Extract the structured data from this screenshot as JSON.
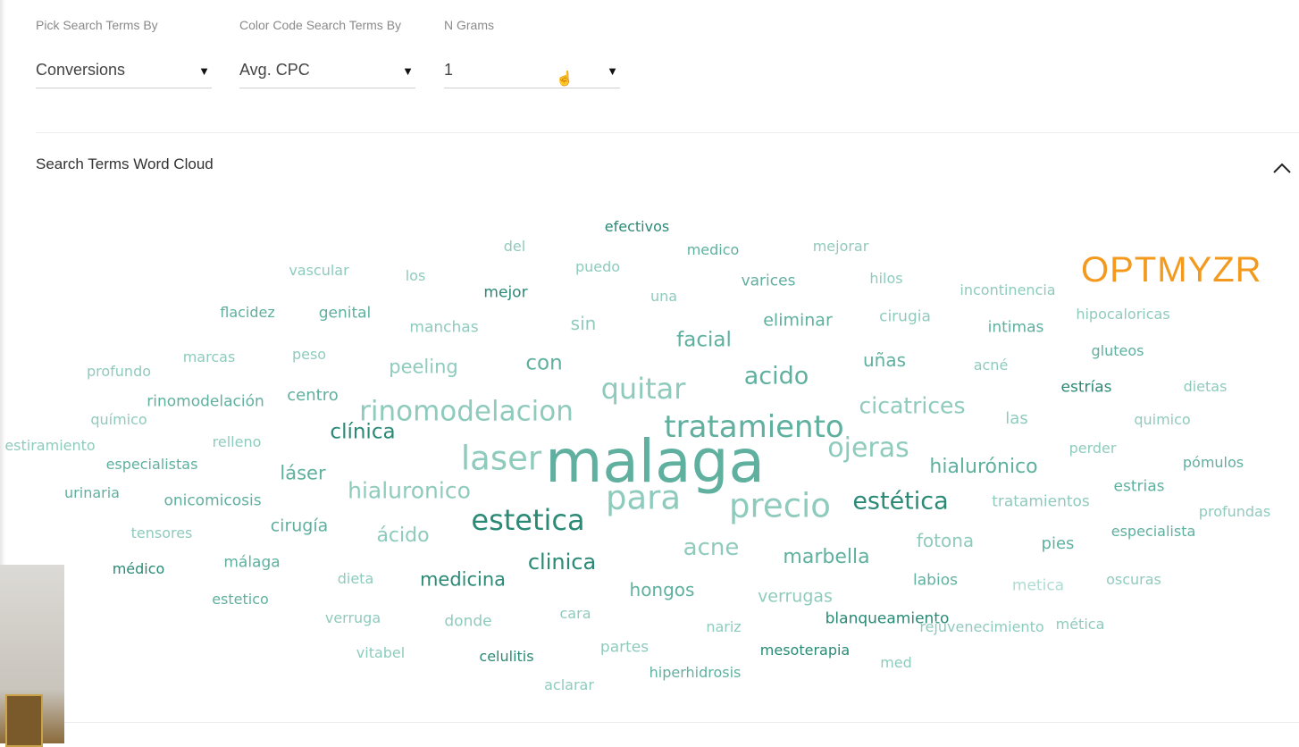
{
  "controls": [
    {
      "label": "Pick Search Terms By",
      "value": "Conversions"
    },
    {
      "label": "Color Code Search Terms By",
      "value": "Avg. CPC"
    },
    {
      "label": "N Grams",
      "value": "1"
    }
  ],
  "section": {
    "title": "Search Terms Word Cloud",
    "collapse_icon": "chevron-up-icon"
  },
  "logo": "OPTMYZR",
  "colors": {
    "dark": "#2a8a76",
    "mid": "#5fb09f",
    "light": "#8fcbbd",
    "lightest": "#aedcd2",
    "logo": "#f39a1e"
  },
  "word_cloud": [
    {
      "text": "efectivos",
      "shade": "dark"
    },
    {
      "text": "medico",
      "shade": "mid"
    },
    {
      "text": "del",
      "shade": "light"
    },
    {
      "text": "mejorar",
      "shade": "light"
    },
    {
      "text": "vascular",
      "shade": "light"
    },
    {
      "text": "los",
      "shade": "light"
    },
    {
      "text": "puedo",
      "shade": "light"
    },
    {
      "text": "hilos",
      "shade": "light"
    },
    {
      "text": "varices",
      "shade": "mid"
    },
    {
      "text": "mejor",
      "shade": "dark"
    },
    {
      "text": "una",
      "shade": "light"
    },
    {
      "text": "incontinencia",
      "shade": "light"
    },
    {
      "text": "flacidez",
      "shade": "mid"
    },
    {
      "text": "genital",
      "shade": "mid"
    },
    {
      "text": "manchas",
      "shade": "light"
    },
    {
      "text": "sin",
      "shade": "light"
    },
    {
      "text": "eliminar",
      "shade": "mid"
    },
    {
      "text": "cirugia",
      "shade": "light"
    },
    {
      "text": "intimas",
      "shade": "mid"
    },
    {
      "text": "hipocaloricas",
      "shade": "light"
    },
    {
      "text": "facial",
      "shade": "mid"
    },
    {
      "text": "marcas",
      "shade": "light"
    },
    {
      "text": "peso",
      "shade": "light"
    },
    {
      "text": "peeling",
      "shade": "light"
    },
    {
      "text": "con",
      "shade": "mid"
    },
    {
      "text": "acido",
      "shade": "mid"
    },
    {
      "text": "uñas",
      "shade": "mid"
    },
    {
      "text": "acné",
      "shade": "light"
    },
    {
      "text": "gluteos",
      "shade": "mid"
    },
    {
      "text": "profundo",
      "shade": "light"
    },
    {
      "text": "quitar",
      "shade": "light"
    },
    {
      "text": "rinomodelación",
      "shade": "mid"
    },
    {
      "text": "centro",
      "shade": "mid"
    },
    {
      "text": "estrías",
      "shade": "dark"
    },
    {
      "text": "dietas",
      "shade": "light"
    },
    {
      "text": "rinomodelacion",
      "shade": "light"
    },
    {
      "text": "cicatrices",
      "shade": "light"
    },
    {
      "text": "tratamiento",
      "shade": "mid"
    },
    {
      "text": "químico",
      "shade": "light"
    },
    {
      "text": "clínica",
      "shade": "dark"
    },
    {
      "text": "las",
      "shade": "light"
    },
    {
      "text": "quimico",
      "shade": "light"
    },
    {
      "text": "estiramiento",
      "shade": "light"
    },
    {
      "text": "relleno",
      "shade": "light"
    },
    {
      "text": "malaga",
      "shade": "mid"
    },
    {
      "text": "laser",
      "shade": "light"
    },
    {
      "text": "ojeras",
      "shade": "light"
    },
    {
      "text": "perder",
      "shade": "light"
    },
    {
      "text": "especialistas",
      "shade": "mid"
    },
    {
      "text": "láser",
      "shade": "mid"
    },
    {
      "text": "hialurónico",
      "shade": "mid"
    },
    {
      "text": "pómulos",
      "shade": "mid"
    },
    {
      "text": "urinaria",
      "shade": "mid"
    },
    {
      "text": "onicomicosis",
      "shade": "mid"
    },
    {
      "text": "hialuronico",
      "shade": "light"
    },
    {
      "text": "para",
      "shade": "light"
    },
    {
      "text": "precio",
      "shade": "light"
    },
    {
      "text": "estética",
      "shade": "dark"
    },
    {
      "text": "estrias",
      "shade": "mid"
    },
    {
      "text": "tratamientos",
      "shade": "light"
    },
    {
      "text": "profundas",
      "shade": "light"
    },
    {
      "text": "estetica",
      "shade": "dark"
    },
    {
      "text": "tensores",
      "shade": "light"
    },
    {
      "text": "cirugía",
      "shade": "mid"
    },
    {
      "text": "ácido",
      "shade": "light"
    },
    {
      "text": "fotona",
      "shade": "light"
    },
    {
      "text": "pies",
      "shade": "mid"
    },
    {
      "text": "especialista",
      "shade": "mid"
    },
    {
      "text": "acne",
      "shade": "light"
    },
    {
      "text": "médico",
      "shade": "dark"
    },
    {
      "text": "málaga",
      "shade": "mid"
    },
    {
      "text": "marbella",
      "shade": "mid"
    },
    {
      "text": "clinica",
      "shade": "dark"
    },
    {
      "text": "dieta",
      "shade": "light"
    },
    {
      "text": "medicina",
      "shade": "dark"
    },
    {
      "text": "labios",
      "shade": "mid"
    },
    {
      "text": "metica",
      "shade": "lightest"
    },
    {
      "text": "oscuras",
      "shade": "light"
    },
    {
      "text": "hongos",
      "shade": "mid"
    },
    {
      "text": "estetico",
      "shade": "mid"
    },
    {
      "text": "verrugas",
      "shade": "light"
    },
    {
      "text": "verruga",
      "shade": "light"
    },
    {
      "text": "donde",
      "shade": "light"
    },
    {
      "text": "cara",
      "shade": "light"
    },
    {
      "text": "blanqueamiento",
      "shade": "dark"
    },
    {
      "text": "nariz",
      "shade": "light"
    },
    {
      "text": "rejuvenecimiento",
      "shade": "light"
    },
    {
      "text": "mética",
      "shade": "light"
    },
    {
      "text": "partes",
      "shade": "light"
    },
    {
      "text": "mesoterapia",
      "shade": "dark"
    },
    {
      "text": "vitabel",
      "shade": "light"
    },
    {
      "text": "celulitis",
      "shade": "dark"
    },
    {
      "text": "med",
      "shade": "light"
    },
    {
      "text": "hiperhidrosis",
      "shade": "mid"
    },
    {
      "text": "aclarar",
      "shade": "light"
    }
  ]
}
